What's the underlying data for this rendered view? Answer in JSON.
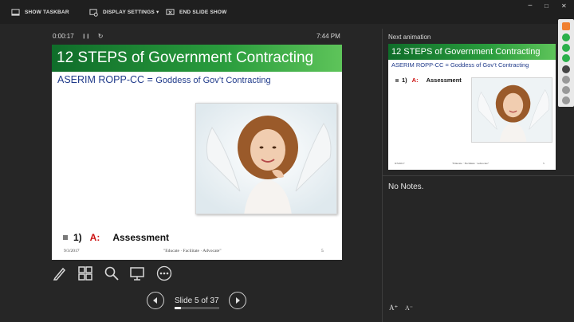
{
  "toolbar": {
    "show_taskbar": "SHOW TASKBAR",
    "display_settings": "DISPLAY SETTINGS ▾",
    "end_slide_show": "END SLIDE SHOW"
  },
  "window": {
    "minimize": "−",
    "maximize": "□",
    "close": "✕"
  },
  "timer": {
    "elapsed": "0:00:17",
    "pause_glyph": "❙❙",
    "reset_glyph": "↻"
  },
  "clock": "7:44 PM",
  "current_slide": {
    "title": "12 STEPS of Government Contracting",
    "subtitle_a": "ASERIM ROPP-CC = ",
    "subtitle_b": "Goddess of Gov’t Contracting",
    "bullet_num": "1)",
    "bullet_letter": "A:",
    "bullet_text": "Assessment",
    "footer_date": "9/3/2017",
    "footer_center": "\"Educate · Facilitate · Advocate\"",
    "footer_page": "5"
  },
  "next": {
    "label": "Next animation",
    "title": "12 STEPS of Government Contracting",
    "subtitle": "ASERIM ROPP-CC = Goddess of Gov’t Contracting",
    "bullet_num": "1)",
    "bullet_letter": "A:",
    "bullet_text": "Assessment",
    "footer_date": "9/3/2017",
    "footer_center": "\"Educate · Facilitate · Advocate\"",
    "footer_page": "5"
  },
  "notes": "No Notes.",
  "navigation": {
    "slide_counter": "Slide 5 of 37",
    "progress": 0.135
  },
  "font_controls": {
    "increase": "A⁺",
    "decrease": "A⁻"
  },
  "colors": {
    "title_bar": "#2a9d3d",
    "subtitle": "#1f3a8a",
    "accent_red": "#cc1111",
    "background": "#262626"
  }
}
